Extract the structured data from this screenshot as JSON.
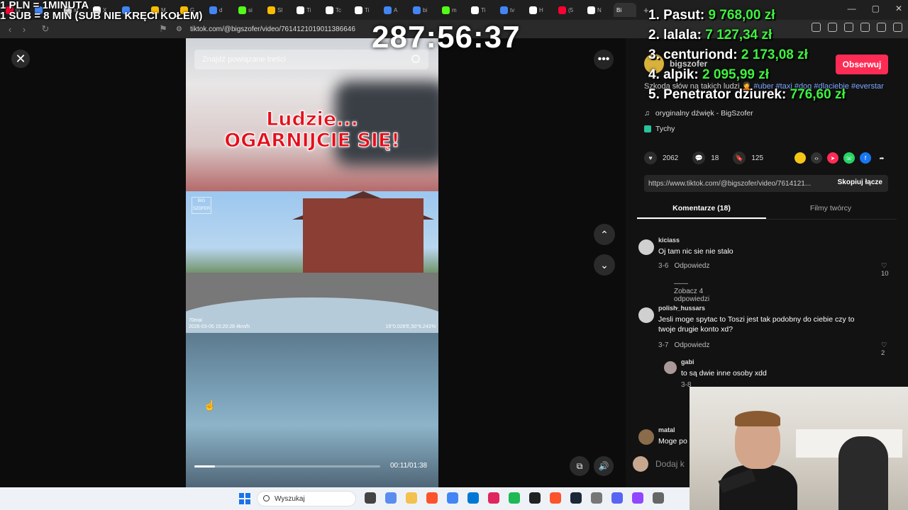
{
  "overlay": {
    "rate_line_1": "1 PLN = 1MINUTA",
    "rate_line_2": "1 SUB = 8 MIN (SUB NIE KRĘCI KOŁEM)",
    "timer": "287:56:37",
    "ranking": [
      {
        "label": "1. Pasut:",
        "amount": "9 768,00 zł"
      },
      {
        "label": "2. lalala:",
        "amount": "7 127,34 zł"
      },
      {
        "label": "3. centuriond:",
        "amount": "2 173,08 zł"
      },
      {
        "label": "4. alpik:",
        "amount": "2 095,99 zł"
      },
      {
        "label": "5. Penetrator dziurek:",
        "amount": "776,60 zł"
      }
    ]
  },
  "browser": {
    "url": "tiktok.com/@bigszofer/video/7614121019011386646",
    "tabs": [
      {
        "text": "ul",
        "color": "#ff0033"
      },
      {
        "text": "",
        "color": "#4285f4"
      },
      {
        "text": "M",
        "color": "#e4e4e4"
      },
      {
        "text": "X",
        "color": "#ffffff"
      },
      {
        "text": "",
        "color": "#4285f4"
      },
      {
        "text": "M",
        "color": "#fbbc05"
      },
      {
        "text": "G",
        "color": "#fbbc05"
      },
      {
        "text": "d",
        "color": "#4285f4"
      },
      {
        "text": "si",
        "color": "#53fc18"
      },
      {
        "text": "Sl",
        "color": "#fbbc05"
      },
      {
        "text": "Ti",
        "color": "#ffffff"
      },
      {
        "text": "Tc",
        "color": "#ffffff"
      },
      {
        "text": "Ti",
        "color": "#ffffff"
      },
      {
        "text": "A",
        "color": "#4285f4"
      },
      {
        "text": "bi",
        "color": "#4285f4"
      },
      {
        "text": "m",
        "color": "#53fc18"
      },
      {
        "text": "Ti",
        "color": "#ffffff"
      },
      {
        "text": "tv",
        "color": "#4285f4"
      },
      {
        "text": "H",
        "color": "#ffffff"
      },
      {
        "text": "(5",
        "color": "#ff0033"
      },
      {
        "text": "N",
        "color": "#ffffff"
      }
    ],
    "active_tab": "Bi"
  },
  "video": {
    "search_placeholder": "Znajdź powiązane treści",
    "headline_1": "Ludzie...",
    "headline_2": "OGARNIJCIE SIĘ!",
    "logo_mark": "BIG SZOFER",
    "dashcam_brand": "70mai",
    "dashcam_stamp": "2026-03-05 15:20:28  4km/h",
    "dashcam_gps": "19°0.028'E,50°6.243'N",
    "progress": 0.11,
    "time": "00:11/01:38"
  },
  "panel": {
    "author_name": "bigszofer",
    "follow_label": "Obserwuj",
    "desc_text": "Szkoda słów na takich ludzi 🤦",
    "desc_tags": "#uber #taxi #dog #dlaciebie #everstar",
    "music": "oryginalny dźwięk - BigSzofer",
    "location": "Tychy",
    "likes": "2062",
    "comments": "18",
    "saves": "125",
    "link": "https://www.tiktok.com/@bigszofer/video/7614121...",
    "copy_label": "Skopiuj łącze",
    "tab_comments": "Komentarze (18)",
    "tab_creator": "Filmy twórcy",
    "comment_list": [
      {
        "user": "kiciass",
        "text": "Oj tam nic sie nie stalo",
        "date": "3-6",
        "reply": "Odpowiedz",
        "likes": "10",
        "more": "Zobacz 4 odpowiedzi"
      },
      {
        "user": "polish_hussars",
        "text": "Jesli moge spytac to Toszi jest tak podobny do ciebie czy to twoje drugie konto xd?",
        "date": "3-7",
        "reply": "Odpowiedz",
        "likes": "2"
      },
      {
        "user": "gabi",
        "text": "to są dwie inne osoby xdd",
        "date": "3-8"
      },
      {
        "user": "matal",
        "text": "Moge po"
      }
    ],
    "add_comment_placeholder": "Dodaj k"
  },
  "taskbar": {
    "search_label": "Wyszukaj",
    "icons": [
      "#444",
      "#5b8def",
      "#f2c14e",
      "#fb542b",
      "#4285f4",
      "#0078d4",
      "#e0245e",
      "#1db954",
      "#222",
      "#fb542b",
      "#1b2838",
      "#777",
      "#5865f2",
      "#9146ff",
      "#666"
    ]
  }
}
